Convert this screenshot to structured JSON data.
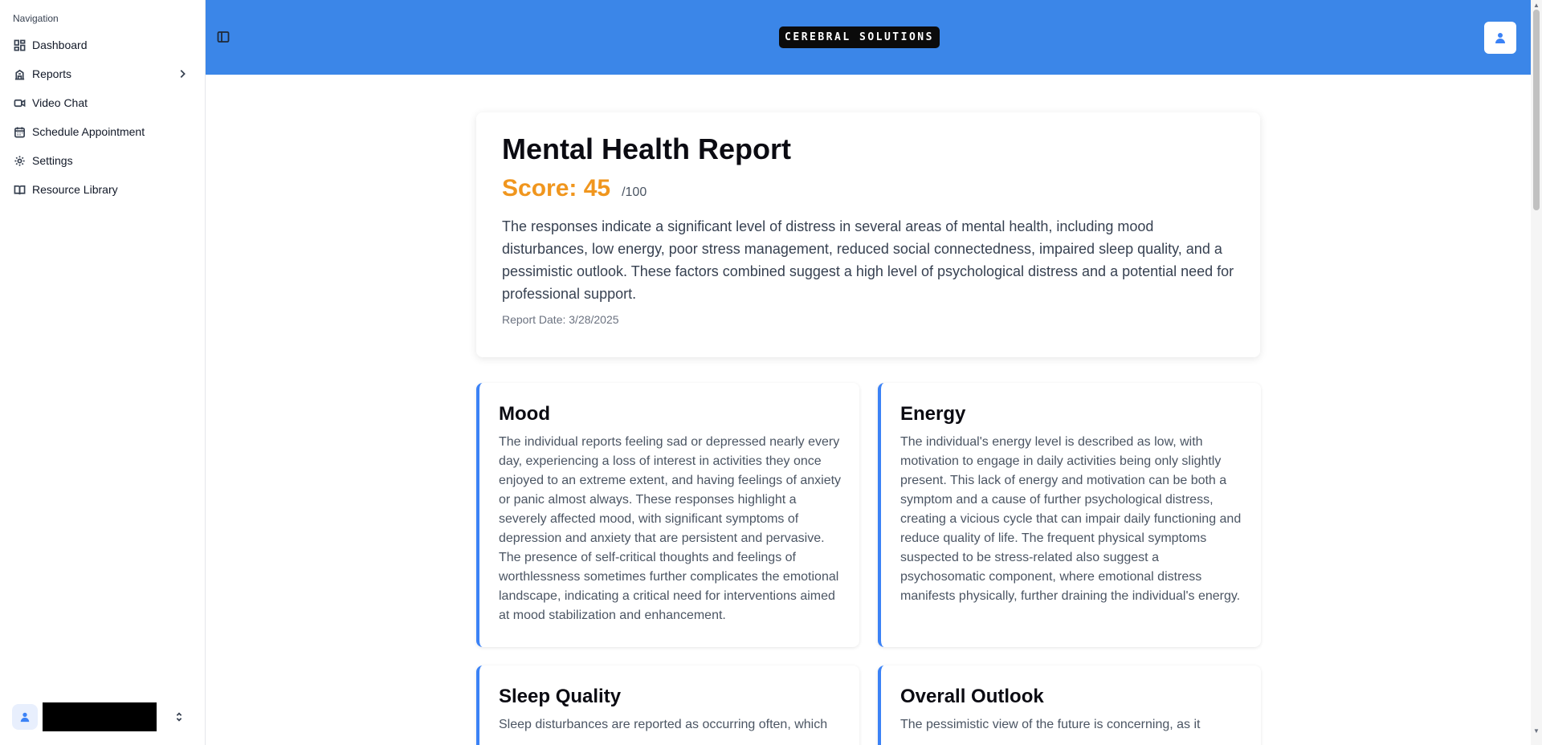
{
  "sidebar": {
    "heading": "Navigation",
    "items": [
      {
        "label": "Dashboard",
        "icon": "dashboard-icon"
      },
      {
        "label": "Reports",
        "icon": "reports-icon"
      },
      {
        "label": "Video Chat",
        "icon": "video-icon"
      },
      {
        "label": "Schedule Appointment",
        "icon": "calendar-icon"
      },
      {
        "label": "Settings",
        "icon": "gear-icon"
      },
      {
        "label": "Resource Library",
        "icon": "book-icon"
      }
    ],
    "user_name_redacted": true
  },
  "header": {
    "logo_text": "CEREBRAL SOLUTIONS",
    "background_color": "#3b86e8"
  },
  "report": {
    "title": "Mental Health Report",
    "score_label": "Score: 45",
    "score_max": "/100",
    "score_color": "#f0961e",
    "summary": "The responses indicate a significant level of distress in several areas of mental health, including mood disturbances, low energy, poor stress management, reduced social connectedness, impaired sleep quality, and a pessimistic outlook. These factors combined suggest a high level of psychological distress and a potential need for professional support.",
    "date": "Report Date: 3/28/2025"
  },
  "categories": [
    {
      "title": "Mood",
      "text": "The individual reports feeling sad or depressed nearly every day, experiencing a loss of interest in activities they once enjoyed to an extreme extent, and having feelings of anxiety or panic almost always. These responses highlight a severely affected mood, with significant symptoms of depression and anxiety that are persistent and pervasive. The presence of self-critical thoughts and feelings of worthlessness sometimes further complicates the emotional landscape, indicating a critical need for interventions aimed at mood stabilization and enhancement."
    },
    {
      "title": "Energy",
      "text": "The individual's energy level is described as low, with motivation to engage in daily activities being only slightly present. This lack of energy and motivation can be both a symptom and a cause of further psychological distress, creating a vicious cycle that can impair daily functioning and reduce quality of life. The frequent physical symptoms suspected to be stress-related also suggest a psychosomatic component, where emotional distress manifests physically, further draining the individual's energy."
    },
    {
      "title": "Sleep Quality",
      "text": "Sleep disturbances are reported as occurring often, which"
    },
    {
      "title": "Overall Outlook",
      "text": "The pessimistic view of the future is concerning, as it"
    }
  ],
  "accent_color": "#3b82f6"
}
